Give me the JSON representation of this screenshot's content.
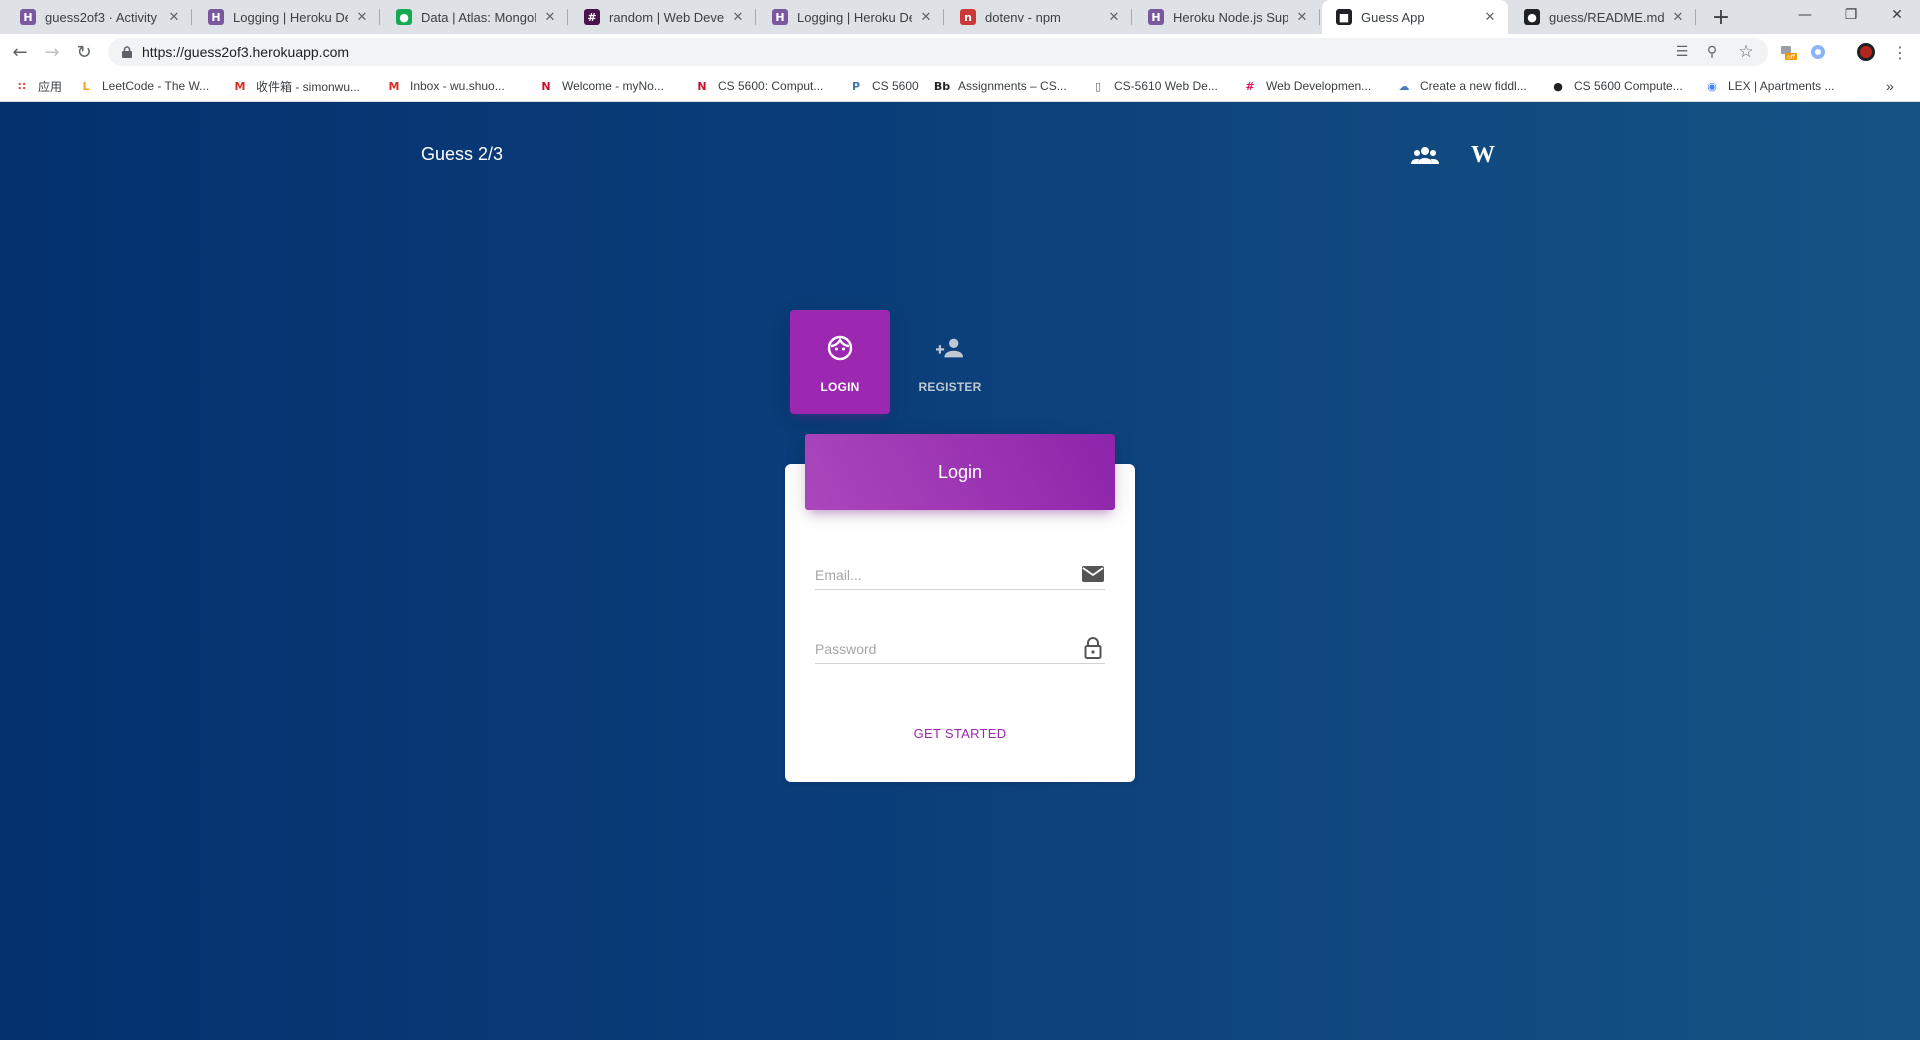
{
  "browser": {
    "tabs": [
      {
        "title": "guess2of3 · Activity |",
        "favicon": "heroku-icon",
        "color": "#79589f",
        "glyph": "H"
      },
      {
        "title": "Logging | Heroku De",
        "favicon": "heroku-icon",
        "color": "#79589f",
        "glyph": "H"
      },
      {
        "title": "Data | Atlas: MongoD",
        "favicon": "mongodb-leaf-icon",
        "color": "#13aa52",
        "glyph": "●"
      },
      {
        "title": "random | Web Develc",
        "favicon": "slack-icon",
        "color": "#4a154b",
        "glyph": "#"
      },
      {
        "title": "Logging | Heroku De",
        "favicon": "heroku-icon",
        "color": "#79589f",
        "glyph": "H"
      },
      {
        "title": "dotenv - npm",
        "favicon": "npm-icon",
        "color": "#cb3837",
        "glyph": "n"
      },
      {
        "title": "Heroku Node.js Supp",
        "favicon": "heroku-icon",
        "color": "#79589f",
        "glyph": "H"
      },
      {
        "title": "Guess App",
        "favicon": "guess-app-icon",
        "color": "#202124",
        "glyph": "■",
        "active": true
      },
      {
        "title": "guess/README.md a",
        "favicon": "github-icon",
        "color": "#202124",
        "glyph": "●"
      }
    ],
    "url": "https://guess2of3.herokuapp.com",
    "bookmarks": [
      {
        "label": "应用",
        "favicon": "apps-grid-icon",
        "color": "#ea4335",
        "glyph": "∷"
      },
      {
        "label": "LeetCode - The W...",
        "favicon": "leetcode-icon",
        "color": "#f89f1b",
        "glyph": "L"
      },
      {
        "label": "收件箱 - simonwu...",
        "favicon": "gmail-icon",
        "color": "#d93025",
        "glyph": "M"
      },
      {
        "label": "Inbox - wu.shuo...",
        "favicon": "gmail-icon",
        "color": "#d93025",
        "glyph": "M"
      },
      {
        "label": "Welcome - myNo...",
        "favicon": "northeastern-icon",
        "color": "#c8102e",
        "glyph": "N"
      },
      {
        "label": "CS 5600: Comput...",
        "favicon": "northeastern-icon",
        "color": "#c8102e",
        "glyph": "N"
      },
      {
        "label": "CS 5600",
        "favicon": "piazza-icon",
        "color": "#3e7aab",
        "glyph": "P"
      },
      {
        "label": "Assignments – CS...",
        "favicon": "blackboard-icon",
        "color": "#262626",
        "glyph": "Bb"
      },
      {
        "label": "CS-5610 Web De...",
        "favicon": "document-icon",
        "color": "#5f6368",
        "glyph": "▯"
      },
      {
        "label": "Web Developmen...",
        "favicon": "slack-icon",
        "color": "#e01e5a",
        "glyph": "#"
      },
      {
        "label": "Create a new fiddl...",
        "favicon": "jsfiddle-icon",
        "color": "#4679bd",
        "glyph": "☁"
      },
      {
        "label": "CS 5600 Compute...",
        "favicon": "github-icon",
        "color": "#202124",
        "glyph": "●"
      },
      {
        "label": "LEX | Apartments ...",
        "favicon": "chrome-icon",
        "color": "#4285f4",
        "glyph": "◉"
      }
    ]
  },
  "app": {
    "brand": "Guess 2/3",
    "tabs": {
      "login": "LOGIN",
      "register": "REGISTER"
    },
    "card_title": "Login",
    "email_placeholder": "Email...",
    "password_placeholder": "Password",
    "cta": "GET STARTED"
  },
  "colors": {
    "accent": "#9c27b0",
    "page_bg": "#0a3e7a"
  }
}
